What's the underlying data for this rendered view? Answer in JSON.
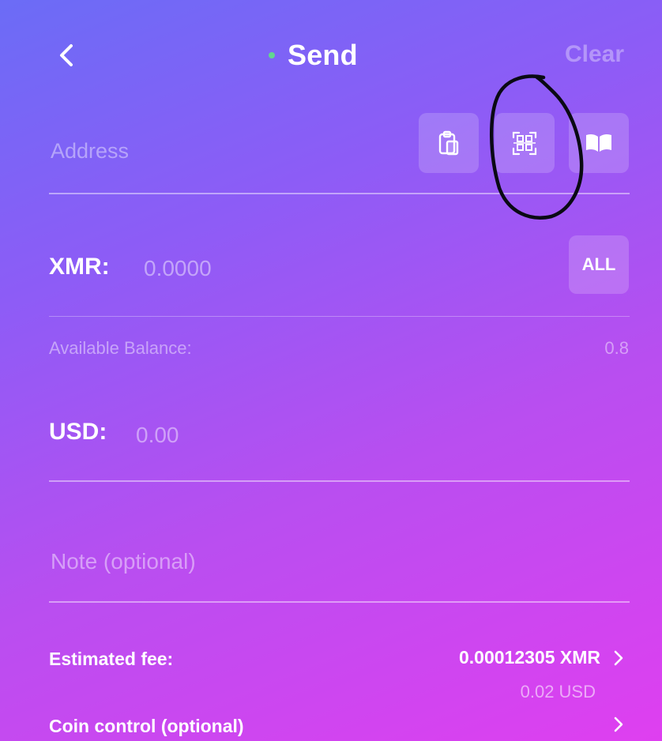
{
  "header": {
    "back_icon": "chevron-left-icon",
    "title": "Send",
    "status_color": "#62d68f",
    "clear_label": "Clear"
  },
  "address": {
    "placeholder": "Address",
    "value": "",
    "paste_icon": "clipboard-icon",
    "scan_icon": "qr-code-scan-icon",
    "address_book_icon": "book-icon"
  },
  "xmr": {
    "label": "XMR:",
    "placeholder": "0.0000",
    "all_label": "ALL"
  },
  "balance": {
    "label": "Available Balance:",
    "value": "0.8"
  },
  "usd": {
    "label": "USD:",
    "placeholder": "0.00"
  },
  "note": {
    "placeholder": "Note (optional)"
  },
  "fee": {
    "label": "Estimated fee:",
    "value": "0.00012305 XMR",
    "usd_value": "0.02 USD"
  },
  "coin_control": {
    "label": "Coin control (optional)"
  },
  "colors": {
    "gradient_start": "#6b6cf6",
    "gradient_end": "#df3ff0",
    "annotation": "#0a0a14"
  }
}
